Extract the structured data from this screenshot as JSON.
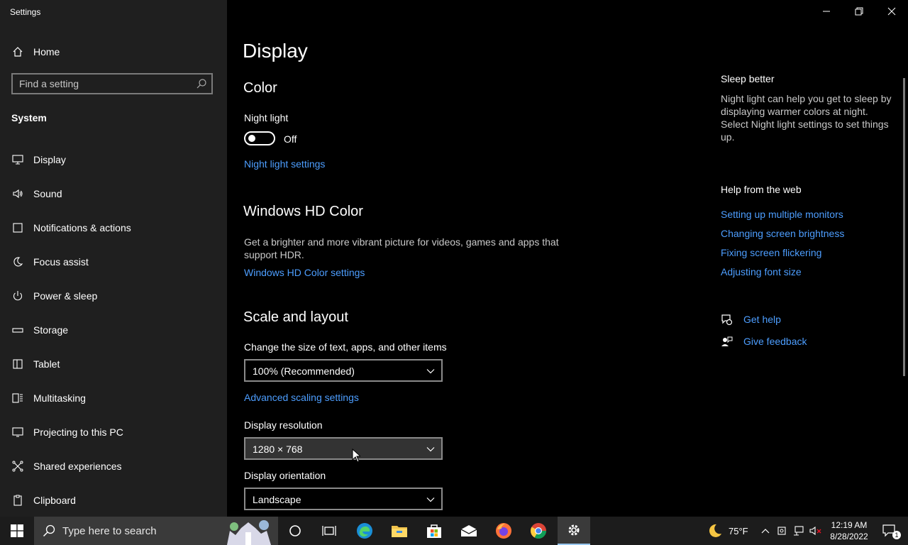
{
  "window": {
    "title": "Settings"
  },
  "sidebar": {
    "home_label": "Home",
    "search_placeholder": "Find a setting",
    "section_label": "System",
    "items": [
      {
        "label": "Display",
        "icon": "monitor-icon"
      },
      {
        "label": "Sound",
        "icon": "speaker-icon"
      },
      {
        "label": "Notifications & actions",
        "icon": "notification-icon"
      },
      {
        "label": "Focus assist",
        "icon": "moon-icon"
      },
      {
        "label": "Power & sleep",
        "icon": "power-icon"
      },
      {
        "label": "Storage",
        "icon": "storage-icon"
      },
      {
        "label": "Tablet",
        "icon": "tablet-icon"
      },
      {
        "label": "Multitasking",
        "icon": "multitasking-icon"
      },
      {
        "label": "Projecting to this PC",
        "icon": "projecting-icon"
      },
      {
        "label": "Shared experiences",
        "icon": "shared-icon"
      },
      {
        "label": "Clipboard",
        "icon": "clipboard-icon"
      }
    ]
  },
  "main": {
    "title": "Display",
    "color": {
      "heading": "Color",
      "night_light_label": "Night light",
      "night_light_state": "Off",
      "night_light_link": "Night light settings"
    },
    "hd_color": {
      "heading": "Windows HD Color",
      "description": "Get a brighter and more vibrant picture for videos, games and apps that support HDR.",
      "link": "Windows HD Color settings"
    },
    "scale": {
      "heading": "Scale and layout",
      "size_label": "Change the size of text, apps, and other items",
      "size_value": "100% (Recommended)",
      "advanced_link": "Advanced scaling settings",
      "resolution_label": "Display resolution",
      "resolution_value": "1280 × 768",
      "orientation_label": "Display orientation",
      "orientation_value": "Landscape"
    }
  },
  "right_panel": {
    "sleep_heading": "Sleep better",
    "sleep_text": "Night light can help you get to sleep by displaying warmer colors at night. Select Night light settings to set things up.",
    "help_heading": "Help from the web",
    "help_links": [
      "Setting up multiple monitors",
      "Changing screen brightness",
      "Fixing screen flickering",
      "Adjusting font size"
    ],
    "get_help": "Get help",
    "give_feedback": "Give feedback"
  },
  "taskbar": {
    "search_placeholder": "Type here to search",
    "weather": "75°F",
    "time": "12:19 AM",
    "date": "8/28/2022",
    "notification_count": "1"
  },
  "colors": {
    "accent": "#4d9eff",
    "sidebar_bg": "#1f1f1f",
    "main_bg": "#000000"
  }
}
